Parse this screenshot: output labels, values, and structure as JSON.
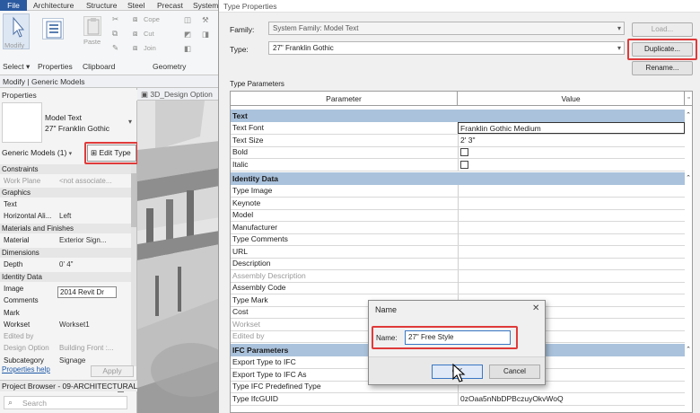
{
  "ribbon": {
    "tabs": [
      "File",
      "Architecture",
      "Structure",
      "Steel",
      "Precast",
      "System"
    ],
    "modify_label": "Modify",
    "paste_label": "Paste",
    "cope_label": "Cope",
    "cut_label": "Cut",
    "join_label": "Join",
    "panels": [
      "Select",
      "Properties",
      "Clipboard",
      "Geometry"
    ]
  },
  "modify_bar": "Modify | Generic Models",
  "properties": {
    "title": "Properties",
    "type_family": "Model Text",
    "type_name": "27\" Franklin Gothic",
    "category_select": "Generic Models (1)",
    "edit_type_label": "Edit Type",
    "apply_label": "Apply",
    "help_link": "Properties help",
    "sections": {
      "constraints": "Constraints",
      "graphics": "Graphics",
      "materials": "Materials and Finishes",
      "dimensions": "Dimensions",
      "identity": "Identity Data"
    },
    "rows": {
      "work_plane": {
        "k": "Work Plane",
        "v": "<not associate..."
      },
      "text": {
        "k": "Text",
        "v": "2014 Revit Dr"
      },
      "halign": {
        "k": "Horizontal Ali...",
        "v": "Left"
      },
      "material": {
        "k": "Material",
        "v": "Exterior Sign..."
      },
      "depth": {
        "k": "Depth",
        "v": "0'  4\""
      },
      "image": {
        "k": "Image",
        "v": ""
      },
      "comments": {
        "k": "Comments",
        "v": ""
      },
      "mark": {
        "k": "Mark",
        "v": ""
      },
      "workset": {
        "k": "Workset",
        "v": "Workset1"
      },
      "edited_by": {
        "k": "Edited by",
        "v": ""
      },
      "design_option": {
        "k": "Design Option",
        "v": "Building Front :..."
      },
      "subcategory": {
        "k": "Subcategory",
        "v": "Signage"
      }
    }
  },
  "project_browser": {
    "title": "Project Browser - 09-ARCHITECTURAL_...",
    "search_placeholder": "Search"
  },
  "view_tab": "3D_Design Option",
  "type_properties": {
    "title": "Type Properties",
    "family_label": "Family:",
    "family_value": "System Family: Model Text",
    "type_label": "Type:",
    "type_value": "27\" Franklin Gothic",
    "load_label": "Load...",
    "duplicate_label": "Duplicate...",
    "rename_label": "Rename...",
    "type_parameters_label": "Type Parameters",
    "col_parameter": "Parameter",
    "col_value": "Value",
    "groups": {
      "text": "Text",
      "identity": "Identity Data",
      "ifc": "IFC Parameters"
    },
    "text_rows": [
      {
        "k": "Text Font",
        "v": "Franklin Gothic Medium"
      },
      {
        "k": "Text Size",
        "v": "2'  3\""
      },
      {
        "k": "Bold",
        "v": ""
      },
      {
        "k": "Italic",
        "v": ""
      }
    ],
    "identity_rows": [
      {
        "k": "Type Image",
        "v": ""
      },
      {
        "k": "Keynote",
        "v": ""
      },
      {
        "k": "Model",
        "v": ""
      },
      {
        "k": "Manufacturer",
        "v": ""
      },
      {
        "k": "Type Comments",
        "v": ""
      },
      {
        "k": "URL",
        "v": ""
      },
      {
        "k": "Description",
        "v": ""
      },
      {
        "k": "Assembly Description",
        "v": ""
      },
      {
        "k": "Assembly Code",
        "v": ""
      },
      {
        "k": "Type Mark",
        "v": ""
      },
      {
        "k": "Cost",
        "v": ""
      },
      {
        "k": "Workset",
        "v": ""
      },
      {
        "k": "Edited by",
        "v": ""
      }
    ],
    "ifc_rows": [
      {
        "k": "Export Type to IFC",
        "v": ""
      },
      {
        "k": "Export Type to IFC As",
        "v": ""
      },
      {
        "k": "Type IFC Predefined Type",
        "v": ""
      },
      {
        "k": "Type IfcGUID",
        "v": "0zOaa5nNbDPBczuyOkvWoQ"
      }
    ]
  },
  "name_dialog": {
    "title": "Name",
    "name_label": "Name:",
    "name_value": "27\" Free Style",
    "ok_label": "OK",
    "cancel_label": "Cancel"
  },
  "colors": {
    "highlight": "#e03a3a",
    "group_header": "#aac2dc",
    "file_tab": "#2b5aa0"
  }
}
